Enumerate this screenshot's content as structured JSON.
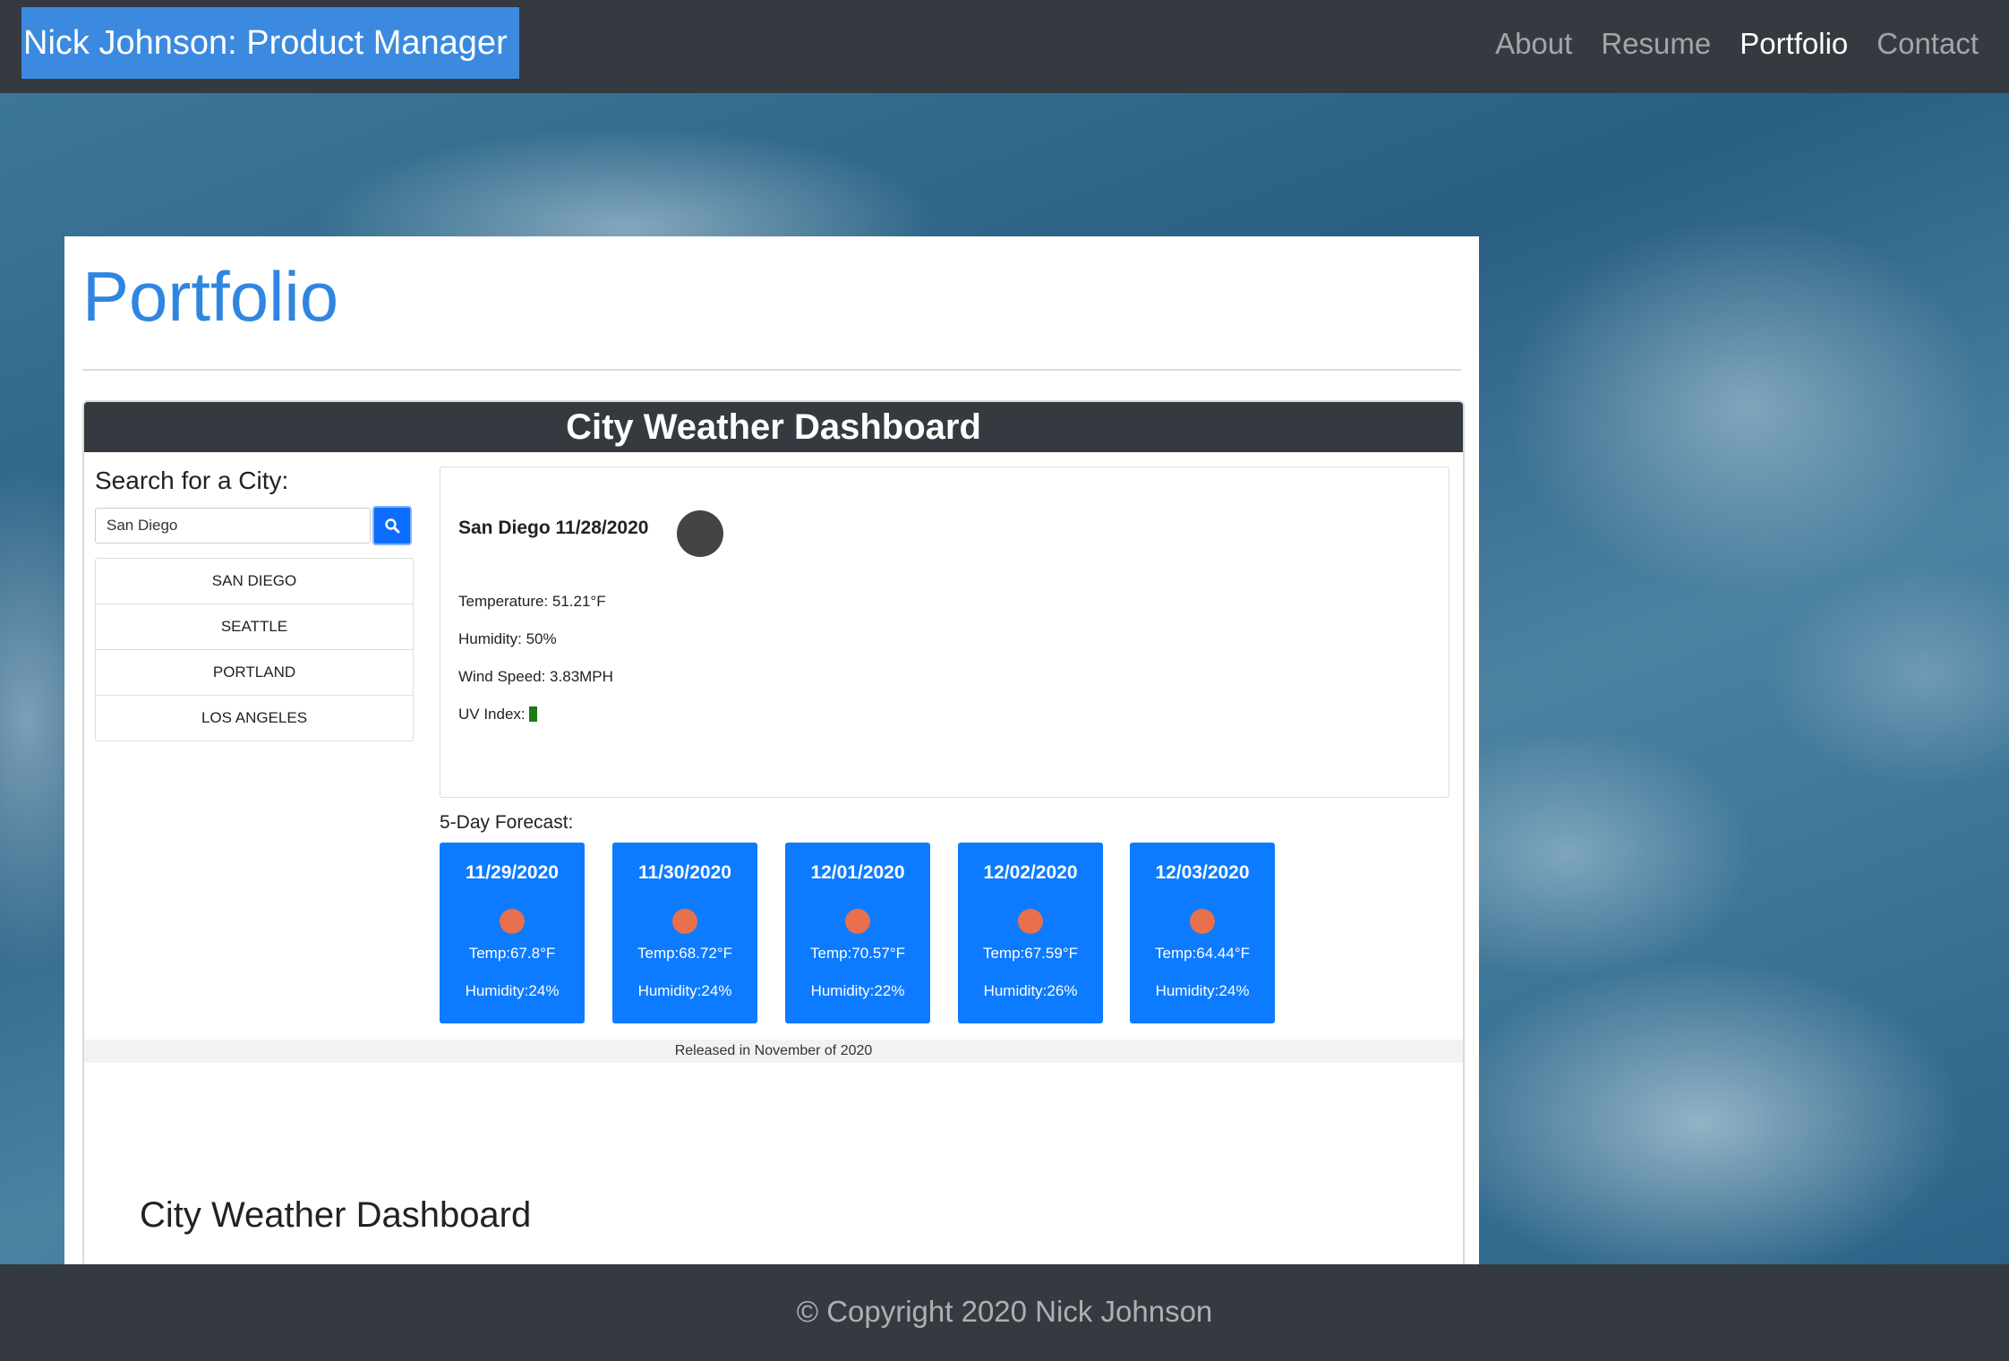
{
  "navbar": {
    "brand": "Nick Johnson: Product Manager",
    "links": [
      "About",
      "Resume",
      "Portfolio",
      "Contact"
    ],
    "active": "Portfolio"
  },
  "page": {
    "title": "Portfolio"
  },
  "project": {
    "header": "City Weather Dashboard",
    "search": {
      "label": "Search for a City:",
      "value": "San Diego"
    },
    "cities": [
      "SAN DIEGO",
      "SEATTLE",
      "PORTLAND",
      "LOS ANGELES"
    ],
    "current": {
      "title": "San Diego 11/28/2020",
      "temperature": "Temperature: 51.21°F",
      "humidity": "Humidity: 50%",
      "wind": "Wind Speed: 3.83MPH",
      "uv_label": "UV Index:",
      "uv_color": "#1a7a1a"
    },
    "forecast_label": "5-Day Forecast:",
    "forecast": [
      {
        "date": "11/29/2020",
        "temp": "Temp:67.8°F",
        "humidity": "Humidity:24%"
      },
      {
        "date": "11/30/2020",
        "temp": "Temp:68.72°F",
        "humidity": "Humidity:24%"
      },
      {
        "date": "12/01/2020",
        "temp": "Temp:70.57°F",
        "humidity": "Humidity:22%"
      },
      {
        "date": "12/02/2020",
        "temp": "Temp:67.59°F",
        "humidity": "Humidity:26%"
      },
      {
        "date": "12/03/2020",
        "temp": "Temp:64.44°F",
        "humidity": "Humidity:24%"
      }
    ],
    "released": "Released in November of 2020",
    "caption_title": "City Weather Dashboard"
  },
  "footer": {
    "text": "© Copyright 2020 Nick Johnson"
  },
  "colors": {
    "navbar": "#343a40",
    "brand": "#3b8ae0",
    "title": "#2f86e0",
    "forecast_card": "#0d7bff",
    "weather_dot": "#e8704c"
  }
}
